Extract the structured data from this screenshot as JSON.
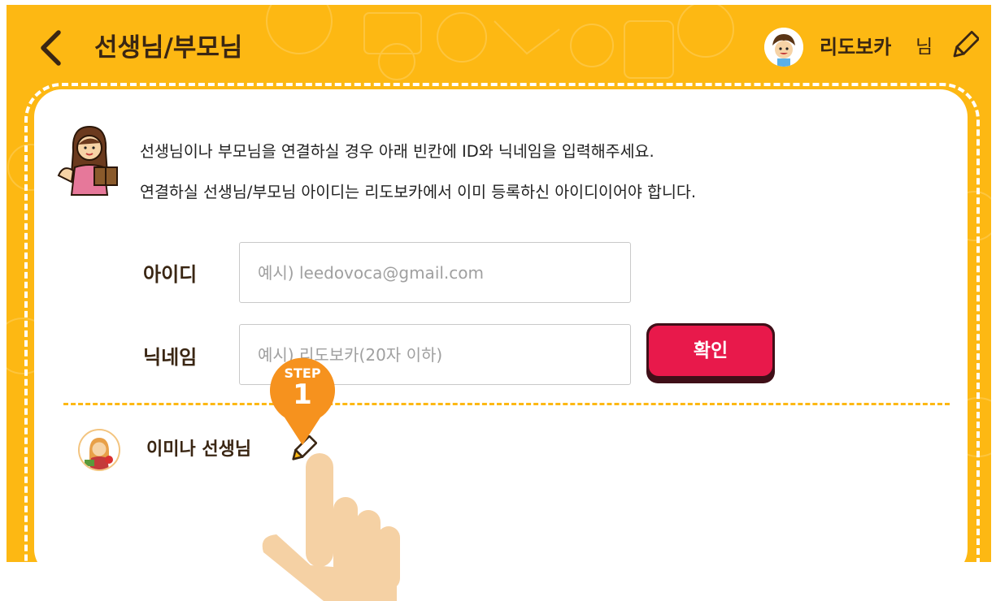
{
  "header": {
    "title": "선생님/부모님",
    "user_name": "리도보카",
    "user_suffix": "님"
  },
  "notice": {
    "line1": "선생님이나 부모님을 연결하실 경우 아래 빈칸에 ID와 닉네임을 입력해주세요.",
    "line2": "연결하실 선생님/부모님 아이디는 리도보카에서 이미 등록하신 아이디이어야 합니다."
  },
  "form": {
    "id_label": "아이디",
    "id_placeholder": "예시) leedovoca@gmail.com",
    "nickname_label": "닉네임",
    "nickname_placeholder": "예시) 리도보카(20자 이하)",
    "confirm_label": "확인"
  },
  "connected": {
    "name": "이미나 선생님"
  },
  "tutorial": {
    "step_label": "STEP",
    "step_number": "1"
  },
  "icons": {
    "back": "chevron-left-icon",
    "edit": "pencil-icon",
    "user_avatar": "boy-avatar-icon",
    "teacher_avatar": "teacher-avatar-icon",
    "tutorial_hand": "pointing-hand-icon"
  },
  "colors": {
    "background": "#fdb813",
    "accent_button": "#e8194b",
    "step_pin": "#f6921e",
    "text_dark": "#3a2613",
    "hand": "#f5d1a4"
  }
}
